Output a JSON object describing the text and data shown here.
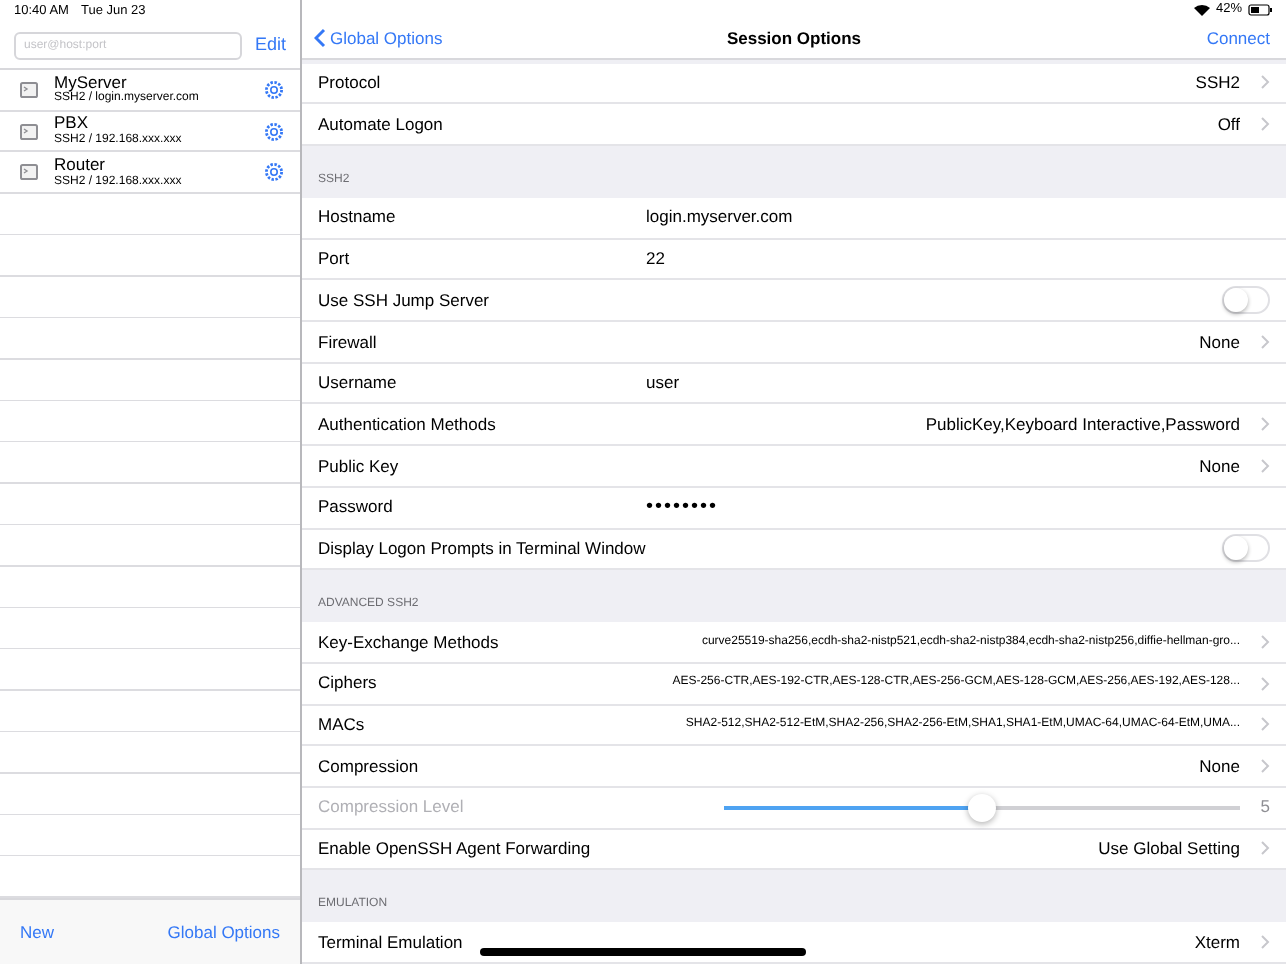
{
  "status_bar": {
    "time": "10:40 AM",
    "date": "Tue Jun 23",
    "battery_text": "42%"
  },
  "sidebar": {
    "search": {
      "placeholder": "user@host:port"
    },
    "edit_button": "Edit",
    "sessions": [
      {
        "name": "MyServer",
        "detail": "SSH2 / login.myserver.com",
        "selected": false
      },
      {
        "name": "PBX",
        "detail": "SSH2 / 192.168.xxx.xxx",
        "selected": false
      },
      {
        "name": "Router",
        "detail": "SSH2 / 192.168.xxx.xxx",
        "selected": false
      }
    ],
    "footer": {
      "new_button": "New",
      "global_options_button": "Global Options"
    }
  },
  "navigation": {
    "back_button": "Global Options",
    "title": "Session Options",
    "action_button": "Connect"
  },
  "sections": [
    {
      "rows": [
        {
          "kind": "detail",
          "label": "Protocol",
          "value": "SSH2"
        },
        {
          "kind": "detail",
          "label": "Automate Logon",
          "value": "Off"
        }
      ]
    },
    {
      "header": "SSH2",
      "rows": [
        {
          "kind": "text",
          "label": "Hostname",
          "value": "login.myserver.com"
        },
        {
          "kind": "text",
          "label": "Port",
          "value": "22"
        },
        {
          "kind": "switch",
          "label": "Use SSH Jump Server",
          "on": false
        },
        {
          "kind": "detail",
          "label": "Firewall",
          "value": "None"
        },
        {
          "kind": "text",
          "label": "Username",
          "value": "user"
        },
        {
          "kind": "detail",
          "label": "Authentication Methods",
          "value": "PublicKey,Keyboard Interactive,Password"
        },
        {
          "kind": "detail",
          "label": "Public Key",
          "value": "None"
        },
        {
          "kind": "secret",
          "label": "Password",
          "value": "••••••••"
        },
        {
          "kind": "switch",
          "label": "Display Logon Prompts in Terminal Window",
          "on": false
        }
      ]
    },
    {
      "header": "ADVANCED SSH2",
      "rows": [
        {
          "kind": "detail",
          "label": "Key-Exchange Methods",
          "value": "curve25519-sha256,ecdh-sha2-nistp521,ecdh-sha2-nistp384,ecdh-sha2-nistp256,diffie-hellman-gro...",
          "small": true
        },
        {
          "kind": "detail",
          "label": "Ciphers",
          "value": "AES-256-CTR,AES-192-CTR,AES-128-CTR,AES-256-GCM,AES-128-GCM,AES-256,AES-192,AES-128...",
          "small": true
        },
        {
          "kind": "detail",
          "label": "MACs",
          "value": "SHA2-512,SHA2-512-EtM,SHA2-256,SHA2-256-EtM,SHA1,SHA1-EtM,UMAC-64,UMAC-64-EtM,UMA...",
          "small": true
        },
        {
          "kind": "detail",
          "label": "Compression",
          "value": "None"
        },
        {
          "kind": "slider",
          "label": "Compression Level",
          "level": 0.5,
          "reading": "5",
          "disabled": true
        },
        {
          "kind": "detail",
          "label": "Enable OpenSSH Agent Forwarding",
          "value": "Use Global Setting"
        }
      ]
    },
    {
      "header": "EMULATION",
      "rows": [
        {
          "kind": "detail",
          "label": "Terminal Emulation",
          "value": "Xterm"
        }
      ]
    }
  ]
}
